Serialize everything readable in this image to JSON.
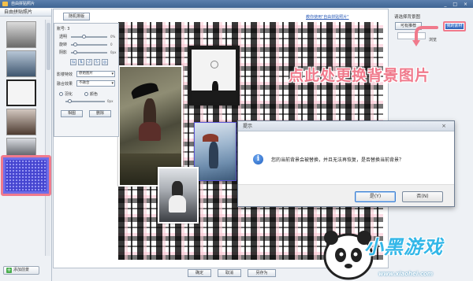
{
  "window": {
    "title": "自由拼贴照片",
    "controls": "_ □ ×"
  },
  "left_panel": {
    "title": "自由拼贴照片",
    "add_background_label": "添加前景"
  },
  "toolbar": {
    "random_layout": "随机排版"
  },
  "canvas": {
    "hint_link": "教你使用\"自由拼贴照片\""
  },
  "control_panel": {
    "items_label": "账号: 3",
    "transparency_label": "透明",
    "transparency_value": "0%",
    "rotate_label": "旋转",
    "rotate_value": "0",
    "shadow_label": "阴影",
    "shadow_value": "0px",
    "effect_label": "影楼特效",
    "effect_value": "原始图片",
    "blend_label": "融合效果",
    "blend_value": "不融合",
    "feather_label": "羽化",
    "fade_label": "颜色",
    "feather_value": "0px",
    "picture_button": "相图",
    "delete_button": "删除"
  },
  "right_panel": {
    "select_bg_label": "请选择背景图",
    "recommend_button": "可有推荐",
    "my_material_button": "我的素材",
    "browse_label": "浏览"
  },
  "annotation": "点此处更换背景图片",
  "dialog": {
    "title": "提示",
    "message": "您的当前背景会被替换，并且无法再恢复，是否替换当前背景？",
    "yes": "是(Y)",
    "no": "否(N)",
    "close": "×"
  },
  "bottom_bar": {
    "ok": "确定",
    "cancel": "取消",
    "save_as": "另存为"
  },
  "watermark": {
    "text": "小黑游戏",
    "url": "www.xiaohei.com"
  },
  "colors": {
    "accent_pink": "#f07a8c",
    "dialog_blue": "#1f5fbf",
    "pattern_blue": "#4545d0"
  }
}
